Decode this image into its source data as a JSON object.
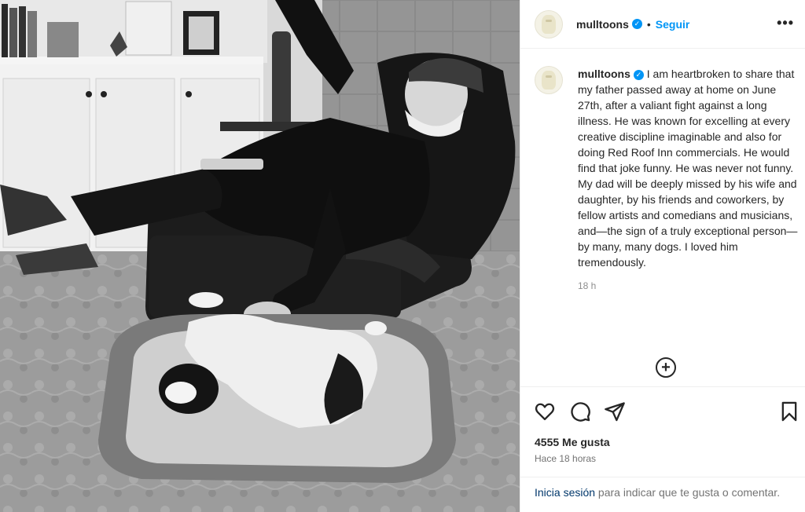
{
  "post": {
    "username": "mulltoons",
    "follow_label": "Seguir",
    "separator": "•",
    "more_label": "•••",
    "verified_mark": "✓",
    "caption": "I am heartbroken to share that my father passed away at home on June 27th, after a valiant fight against a long illness. He was known for excelling at every creative discipline imaginable and also for doing Red Roof Inn commercials. He would find that joke funny. He was never not funny. My dad will be deeply missed by his wife and daughter, by his friends and coworkers, by fellow artists and comedians and musicians, and—the sign of a truly exceptional person—by many, many dogs. I loved him tremendously.",
    "caption_time": "18 h",
    "add_comment_symbol": "+",
    "likes_text": "4555 Me gusta",
    "posted_ago": "Hace 18 horas",
    "login_link": "Inicia sesión",
    "login_rest": " para indicar que te gusta o comentar."
  },
  "icons": {
    "like": "heart-icon",
    "comment": "comment-icon",
    "share": "share-icon",
    "save": "bookmark-icon",
    "options": "more-icon",
    "verified": "verified-badge-icon",
    "add": "add-comment-icon"
  },
  "colors": {
    "accent": "#0095f6",
    "link": "#00376b",
    "text": "#262626",
    "muted": "#737373"
  }
}
